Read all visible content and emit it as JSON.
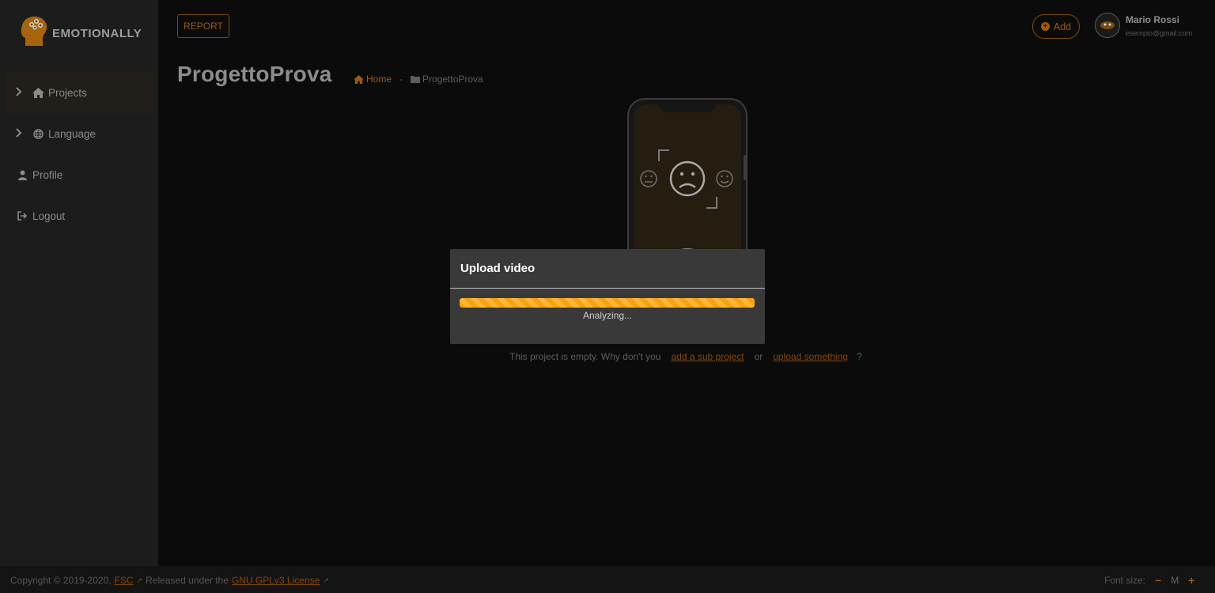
{
  "app": {
    "brand": "EMOTIONALLY",
    "accent": "#f7a20e"
  },
  "sidebar": {
    "items": [
      {
        "label": "Projects",
        "icon": "home-icon",
        "expandable": true,
        "active": true
      },
      {
        "label": "Language",
        "icon": "globe-icon",
        "expandable": true,
        "active": false
      },
      {
        "label": "Profile",
        "icon": "user-icon",
        "expandable": false,
        "active": false
      },
      {
        "label": "Logout",
        "icon": "logout-icon",
        "expandable": false,
        "active": false
      }
    ]
  },
  "header": {
    "report_label": "REPORT",
    "add_label": "Add",
    "user_name": "Mario Rossi",
    "user_email": "esempio@gmail.com"
  },
  "page": {
    "title": "ProgettoProva",
    "breadcrumb": {
      "home": "Home",
      "separator": "-",
      "current": "ProgettoProva"
    }
  },
  "empty_state": {
    "text": "This project is empty. Why don't you",
    "add_link": "add a sub project",
    "or": "or",
    "upload_link": "upload something",
    "question": "?"
  },
  "modal": {
    "title": "Upload video",
    "progress": 1.0,
    "status": "Analyzing..."
  },
  "footer": {
    "copyright": "Copyright © 2019-2020,",
    "org": "FSC",
    "released": "Released under the",
    "license": "GNU GPLv3 License",
    "font_size_label": "Font size:",
    "font_size_minus": "−",
    "font_size_value": "M",
    "font_size_plus": "+"
  }
}
